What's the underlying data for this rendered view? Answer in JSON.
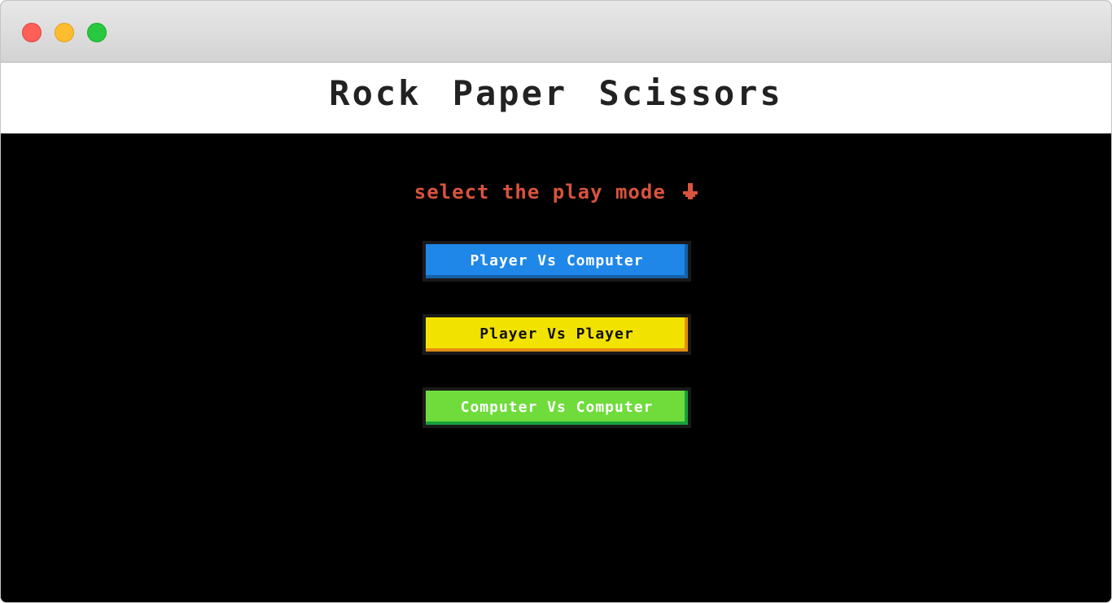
{
  "window": {
    "controls": [
      {
        "name": "close",
        "color": "#fe5f57"
      },
      {
        "name": "minimize",
        "color": "#febc2e"
      },
      {
        "name": "maximize",
        "color": "#28c840"
      }
    ]
  },
  "header": {
    "title": "Rock Paper Scissors"
  },
  "main": {
    "prompt": "select the play mode",
    "prompt_icon": "arrow-down-icon",
    "prompt_color": "#d9533e",
    "modes": [
      {
        "label": "Player Vs Computer",
        "color": "#1f87e8"
      },
      {
        "label": "Player Vs Player",
        "color": "#f2e200"
      },
      {
        "label": "Computer Vs Computer",
        "color": "#6fdc3c"
      }
    ]
  }
}
